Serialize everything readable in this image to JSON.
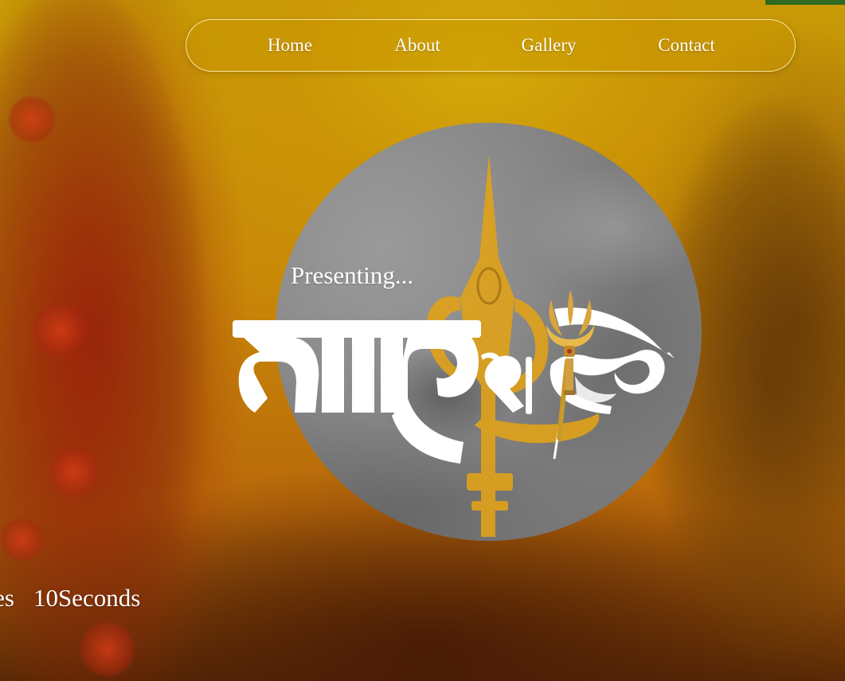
{
  "nav": {
    "items": [
      {
        "label": "Home"
      },
      {
        "label": "About"
      },
      {
        "label": "Gallery"
      },
      {
        "label": "Contact"
      }
    ]
  },
  "hero": {
    "presenting_text": "Presenting...",
    "logo_text": "মাতৃশক্তি",
    "logo_icon": "trishul-icon"
  },
  "countdown": {
    "minutes_label": "utes",
    "seconds_label": "10Seconds"
  },
  "colors": {
    "background": "#c79a06",
    "nav_border": "#fff0aa",
    "text": "#ffffff",
    "trident_gold": "#e0a21a",
    "circle_gray": "#7d7d7d",
    "top_strip": "#2f6a22"
  }
}
